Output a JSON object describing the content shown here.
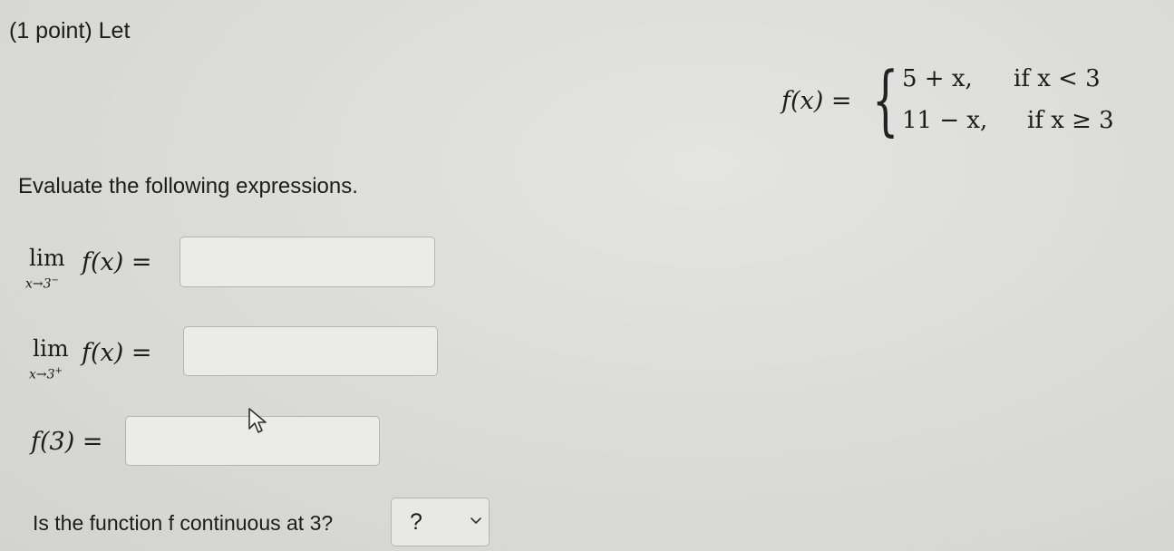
{
  "header": {
    "intro": "(1 point) Let"
  },
  "definition": {
    "lhs": "f(x) =",
    "cases": [
      {
        "expr": "5 + x,",
        "cond": "if x < 3"
      },
      {
        "expr": "11 − x,",
        "cond": "if x ≥ 3"
      }
    ]
  },
  "instructions": "Evaluate the following expressions.",
  "parts": [
    {
      "lim": "lim",
      "sub": "x→3",
      "side": "−",
      "expr": "f(x) =",
      "answer": ""
    },
    {
      "lim": "lim",
      "sub": "x→3",
      "side": "+",
      "expr": "f(x) =",
      "answer": ""
    },
    {
      "expr": "f(3) =",
      "answer": ""
    }
  ],
  "continuity": {
    "question": "Is the function f continuous at 3?",
    "selected": "?"
  },
  "icons": {
    "dropdown": "chevron-down-icon",
    "pointer": "mouse-cursor-icon"
  }
}
